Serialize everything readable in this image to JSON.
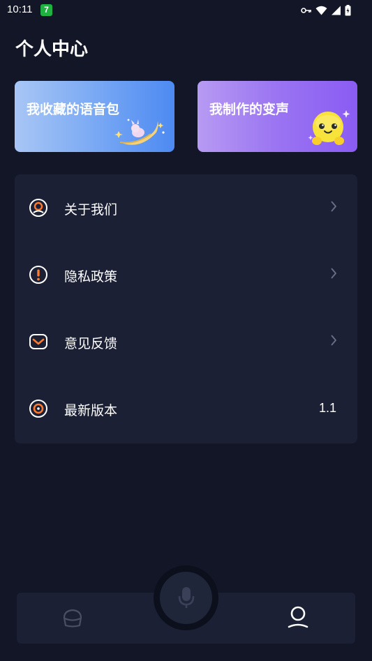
{
  "status_bar": {
    "time": "10:11",
    "badge": "7"
  },
  "page": {
    "title": "个人中心"
  },
  "cards": {
    "voice_pack": {
      "label": "我收藏的语音包"
    },
    "voice_change": {
      "label": "我制作的变声"
    }
  },
  "menu": {
    "items": [
      {
        "label": "关于我们",
        "icon": "user-circle-icon"
      },
      {
        "label": "隐私政策",
        "icon": "exclamation-circle-icon"
      },
      {
        "label": "意见反馈",
        "icon": "mail-icon"
      },
      {
        "label": "最新版本",
        "icon": "target-icon",
        "value": "1.1"
      }
    ]
  },
  "tab_bar": {
    "items": [
      {
        "icon": "home-icon",
        "active": false
      },
      {
        "icon": "microphone-icon",
        "active": false
      },
      {
        "icon": "profile-icon",
        "active": true
      }
    ]
  },
  "colors": {
    "background": "#121626",
    "panel": "#1b2035",
    "accent_orange": "#ff7a2e",
    "card_blue": "#6a9ff4",
    "card_purple": "#9a6ff2"
  }
}
